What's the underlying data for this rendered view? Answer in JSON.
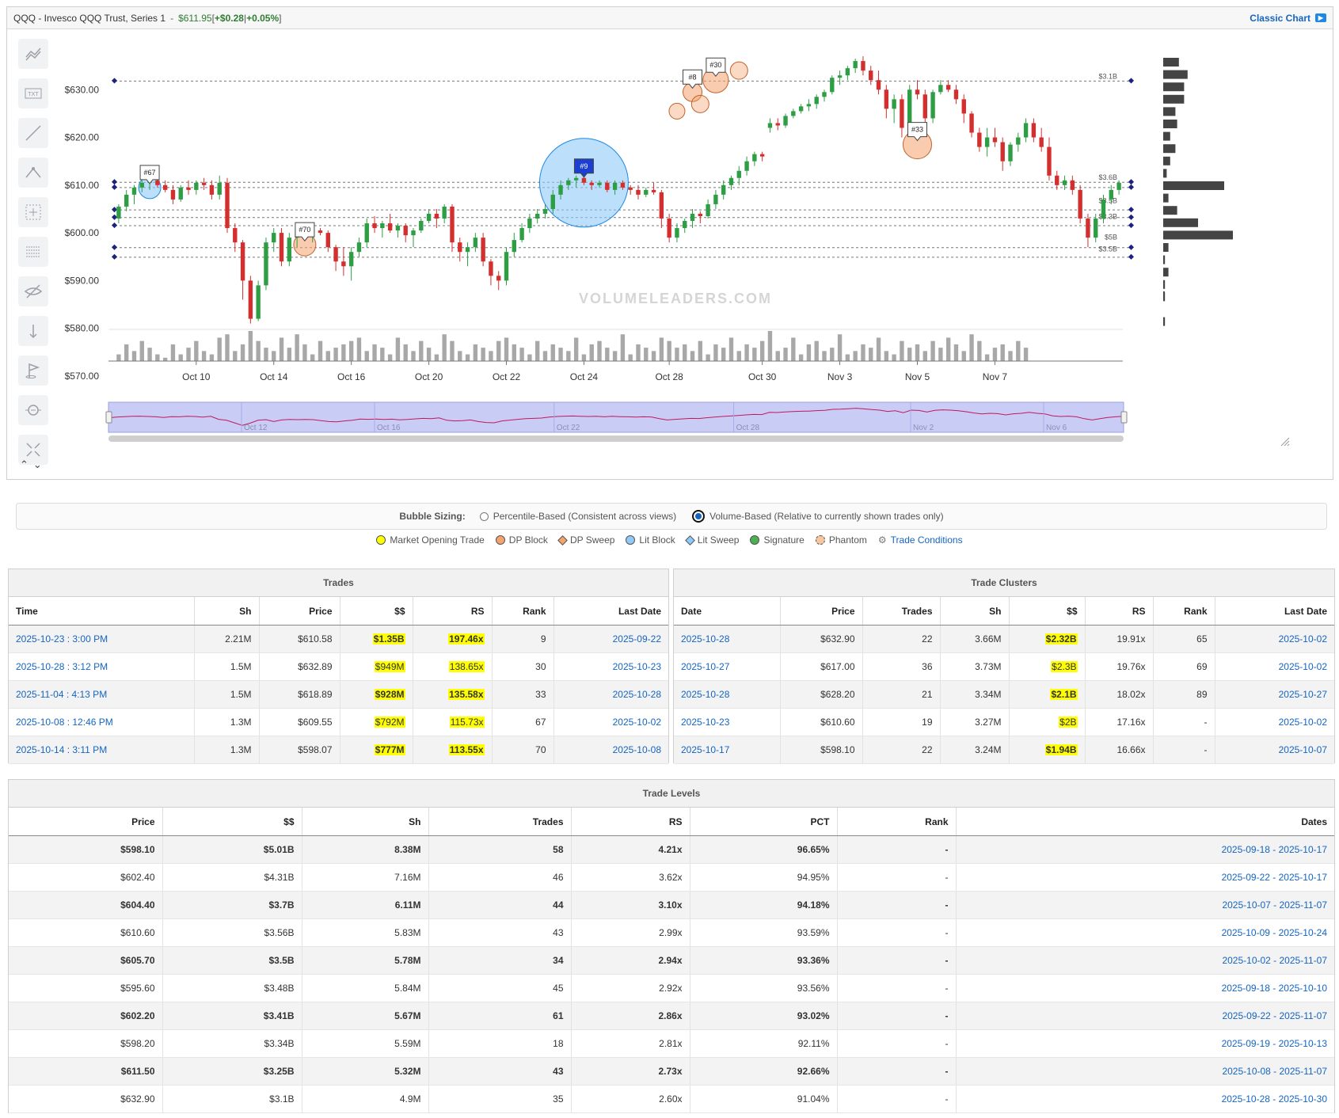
{
  "header": {
    "symbol": "QQQ - Invesco QQQ Trust, Series 1",
    "sep": " - ",
    "price": "$611.95",
    "bracket_open": " [ ",
    "change": "+$0.28",
    "pipe": " | ",
    "change_pct": "+0.05%",
    "bracket_close": " ]",
    "classic_chart": "Classic Chart"
  },
  "toolbar": {
    "tools": [
      "trend-lines-icon",
      "text-icon",
      "line-icon",
      "fibonacci-icon",
      "crosshair-icon",
      "levels-icon",
      "hide-icon",
      "measure-icon",
      "flag-icon",
      "zoom-icon",
      "fullscreen-icon"
    ],
    "arrows": [
      "⌃",
      "⌄"
    ]
  },
  "chart_data": {
    "type": "candlestick",
    "y_ticks": [
      "$630.00",
      "$620.00",
      "$610.00",
      "$600.00",
      "$590.00",
      "$580.00",
      "$570.00"
    ],
    "y_tick_values": [
      630,
      620,
      610,
      600,
      590,
      580,
      570
    ],
    "ylim": [
      567,
      640
    ],
    "x_ticks": [
      "Oct 10",
      "Oct 14",
      "Oct 16",
      "Oct 20",
      "Oct 22",
      "Oct 24",
      "Oct 28",
      "Oct 30",
      "Nov 3",
      "Nov 5",
      "Nov 7"
    ],
    "x_tick_index": [
      10,
      20,
      30,
      40,
      50,
      60,
      71,
      83,
      93,
      103,
      113
    ],
    "candles": [
      [
        603,
        606,
        602,
        605.5
      ],
      [
        605.5,
        609,
        604.5,
        608
      ],
      [
        608,
        610,
        606,
        609.5
      ],
      [
        609.5,
        611.5,
        608.5,
        610.5
      ],
      [
        610.5,
        612,
        609,
        611
      ],
      [
        611,
        612,
        609.5,
        610
      ],
      [
        610,
        611,
        608.5,
        609
      ],
      [
        609,
        610,
        606,
        607
      ],
      [
        607,
        610,
        606.5,
        609.5
      ],
      [
        609.5,
        611,
        608,
        609
      ],
      [
        609,
        611,
        608,
        610.5
      ],
      [
        610.5,
        611.5,
        609,
        610
      ],
      [
        610,
        611,
        607,
        608
      ],
      [
        608,
        612,
        607,
        610.5
      ],
      [
        610.5,
        611.5,
        600,
        601
      ],
      [
        601,
        602,
        596,
        598
      ],
      [
        598,
        598.5,
        586,
        590
      ],
      [
        590,
        591,
        581,
        582
      ],
      [
        582,
        590,
        581.5,
        589
      ],
      [
        589,
        599,
        588,
        598
      ],
      [
        598,
        601,
        596,
        600
      ],
      [
        600,
        601,
        593,
        594
      ],
      [
        594,
        600,
        593,
        599
      ],
      [
        599,
        601,
        597,
        600.5
      ],
      [
        600.5,
        601.5,
        599,
        600
      ],
      [
        600,
        601,
        598,
        600.5
      ],
      [
        600.5,
        601,
        599.5,
        600
      ],
      [
        600,
        600.5,
        596,
        597
      ],
      [
        597,
        597.5,
        592,
        594
      ],
      [
        594,
        597,
        591,
        593
      ],
      [
        593,
        597,
        590,
        596
      ],
      [
        596,
        599,
        595,
        598
      ],
      [
        598,
        603,
        597,
        602
      ],
      [
        602,
        603.5,
        600,
        601
      ],
      [
        601,
        602.5,
        599,
        602
      ],
      [
        602,
        604,
        600,
        600.5
      ],
      [
        600.5,
        602,
        599,
        601.5
      ],
      [
        601.5,
        602,
        598,
        599.5
      ],
      [
        599.5,
        601,
        597,
        600.5
      ],
      [
        600.5,
        603,
        600,
        602.5
      ],
      [
        602.5,
        605,
        602,
        604
      ],
      [
        604,
        605,
        601,
        603
      ],
      [
        603,
        606,
        602,
        605.5
      ],
      [
        605.5,
        606,
        596,
        598
      ],
      [
        598,
        599,
        594,
        596
      ],
      [
        596,
        598,
        593,
        597
      ],
      [
        597,
        600,
        596,
        599
      ],
      [
        599,
        600,
        593,
        594
      ],
      [
        594,
        594.5,
        589,
        591
      ],
      [
        591,
        592,
        588,
        590
      ],
      [
        590,
        597,
        589,
        596
      ],
      [
        596,
        600,
        595,
        598.5
      ],
      [
        598.5,
        602,
        598,
        601
      ],
      [
        601,
        604,
        600,
        603
      ],
      [
        603,
        605,
        602,
        604
      ],
      [
        604,
        606,
        603,
        605
      ],
      [
        605,
        609,
        604,
        608
      ],
      [
        608,
        611,
        607,
        610
      ],
      [
        610,
        611.5,
        609,
        611
      ],
      [
        611,
        612,
        609.5,
        611.5
      ],
      [
        611.5,
        612,
        610,
        610.5
      ],
      [
        610.5,
        611,
        609,
        610
      ],
      [
        610,
        611,
        609.5,
        610.5
      ],
      [
        610.5,
        611,
        608.5,
        609
      ],
      [
        609,
        611,
        608,
        610.5
      ],
      [
        610.5,
        611,
        609,
        609.5
      ],
      [
        609.5,
        610,
        608,
        609
      ],
      [
        609,
        610,
        607,
        608
      ],
      [
        608,
        609.5,
        607.5,
        609
      ],
      [
        609,
        610.5,
        608,
        608.5
      ],
      [
        608.5,
        609,
        601,
        603
      ],
      [
        603,
        604,
        598,
        599
      ],
      [
        599,
        602,
        598,
        601
      ],
      [
        601,
        603,
        600,
        602.5
      ],
      [
        602.5,
        605,
        601,
        604
      ],
      [
        604,
        604.5,
        602,
        603.5
      ],
      [
        603.5,
        607,
        603,
        606
      ],
      [
        606,
        609,
        605,
        608
      ],
      [
        608,
        611,
        607,
        610
      ],
      [
        610,
        612,
        609,
        611.5
      ],
      [
        611.5,
        614,
        610,
        613
      ],
      [
        613,
        616,
        612,
        615
      ],
      [
        615,
        617,
        614,
        616.5
      ],
      [
        616.5,
        617,
        615,
        616
      ],
      [
        622,
        624,
        621,
        623
      ],
      [
        623,
        624,
        621.5,
        622.5
      ],
      [
        622.5,
        625,
        622,
        624.5
      ],
      [
        624.5,
        626,
        624,
        625.5
      ],
      [
        625.5,
        627,
        625,
        626.5
      ],
      [
        626.5,
        628,
        625.5,
        627
      ],
      [
        627,
        629,
        626,
        628.5
      ],
      [
        628.5,
        630,
        627.5,
        629.5
      ],
      [
        629.5,
        633,
        629,
        632.5
      ],
      [
        632.5,
        634,
        631,
        633
      ],
      [
        633,
        635,
        632,
        634.5
      ],
      [
        634.5,
        636.5,
        633.5,
        636
      ],
      [
        636,
        637,
        633,
        634
      ],
      [
        634,
        635,
        631,
        632
      ],
      [
        632,
        634,
        629,
        630
      ],
      [
        630,
        631,
        624,
        626
      ],
      [
        626,
        629,
        623,
        628
      ],
      [
        628,
        629,
        620,
        622
      ],
      [
        622,
        631,
        621,
        630
      ],
      [
        630,
        632,
        628,
        629
      ],
      [
        629,
        630,
        622,
        624
      ],
      [
        624,
        630,
        623,
        629.5
      ],
      [
        629.5,
        632,
        629,
        631
      ],
      [
        631,
        632,
        629.5,
        630
      ],
      [
        630,
        631,
        627,
        628
      ],
      [
        628,
        629,
        623,
        625
      ],
      [
        625,
        625.5,
        620,
        621
      ],
      [
        621,
        622,
        617,
        618
      ],
      [
        618,
        622,
        616,
        620
      ],
      [
        620,
        622,
        618,
        619
      ],
      [
        619,
        620,
        613,
        615
      ],
      [
        615,
        619,
        614,
        618.5
      ],
      [
        618.5,
        621,
        617,
        620
      ],
      [
        620,
        624,
        619,
        623
      ],
      [
        623,
        624,
        619,
        620
      ],
      [
        620,
        622,
        617,
        618
      ],
      [
        618,
        620,
        611,
        612
      ],
      [
        612,
        613,
        609,
        610
      ],
      [
        610,
        612,
        609,
        611
      ],
      [
        611,
        612,
        608,
        609
      ],
      [
        609,
        610,
        602,
        603
      ],
      [
        603,
        604,
        597,
        599
      ],
      [
        599,
        604,
        598,
        603
      ],
      [
        603,
        608,
        602,
        607
      ],
      [
        607,
        610,
        606,
        609
      ],
      [
        609,
        611,
        608,
        610.5
      ]
    ],
    "volume": [
      2,
      5,
      3,
      6,
      4,
      2,
      1,
      5,
      2,
      4,
      6,
      3,
      2,
      7,
      8,
      3,
      5,
      9,
      6,
      4,
      3,
      7,
      4,
      8,
      5,
      2,
      6,
      3,
      4,
      5,
      6,
      7,
      3,
      5,
      4,
      2,
      7,
      5,
      3,
      6,
      4,
      2,
      8,
      6,
      3,
      2,
      5,
      4,
      3,
      6,
      7,
      5,
      4,
      2,
      6,
      3,
      5,
      4,
      3,
      7,
      2,
      5,
      6,
      4,
      3,
      8,
      2,
      5,
      4,
      3,
      7,
      6,
      4,
      5,
      3,
      6,
      2,
      5,
      4,
      7,
      3,
      5,
      4,
      6,
      9,
      3,
      4,
      7,
      2,
      5,
      6,
      3,
      4,
      8,
      2,
      3,
      5,
      4,
      7,
      3,
      2,
      6,
      4,
      5,
      3,
      6,
      4,
      7,
      5,
      3,
      8,
      6,
      2,
      4,
      5,
      3,
      6,
      4
    ],
    "levels": [
      631.8,
      610.6,
      609.5,
      604.8,
      603.2,
      601.5,
      596.9,
      594.9
    ],
    "level_labels": [
      {
        "text": "$3.1B",
        "price": 631.8
      },
      {
        "text": "$3.6B",
        "price": 610.6
      },
      {
        "text": "$3.5B",
        "price": 605.7
      },
      {
        "text": "$3.3B",
        "price": 602.4
      },
      {
        "text": "$5B",
        "price": 598.1
      },
      {
        "text": "$3.5B",
        "price": 595.6
      }
    ],
    "profile": [
      9,
      14,
      12,
      12,
      7,
      8,
      4,
      7,
      4,
      2,
      35,
      3,
      8,
      20,
      40,
      3,
      1,
      3,
      1,
      1,
      0,
      1
    ],
    "markers": [
      {
        "label": "#67",
        "index": 4,
        "price": 609.5,
        "type": "lit",
        "r": 14
      },
      {
        "label": "#70",
        "index": 24,
        "price": 597.5,
        "type": "dp",
        "r": 14
      },
      {
        "label": "#9",
        "index": 60,
        "price": 610.5,
        "type": "lit",
        "r": 56
      },
      {
        "label": "#30",
        "index": 77,
        "price": 632,
        "type": "dp",
        "r": 16
      },
      {
        "label": "#8",
        "index": 74,
        "price": 629.5,
        "type": "dp",
        "r": 12
      },
      {
        "label": "#33",
        "index": 103,
        "price": 618.5,
        "type": "dp",
        "r": 18
      }
    ],
    "watermark": "VOLUMELEADERS.COM",
    "navigator_ticks": [
      "Oct 12",
      "Oct 16",
      "Oct 22",
      "Oct 28",
      "Nov 2",
      "Nov 6"
    ]
  },
  "bubble_sizing": {
    "label": "Bubble Sizing:",
    "option1": "Percentile-Based (Consistent across views)",
    "option2": "Volume-Based (Relative to currently shown trades only)"
  },
  "legend": [
    {
      "label": "Market Opening Trade",
      "color": "#ffff00",
      "shape": "dot"
    },
    {
      "label": "DP Block",
      "color": "#f4a26e",
      "shape": "dot"
    },
    {
      "label": "DP Sweep",
      "color": "#f4a26e",
      "shape": "diamond"
    },
    {
      "label": "Lit Block",
      "color": "#90caf9",
      "shape": "dot"
    },
    {
      "label": "Lit Sweep",
      "color": "#90caf9",
      "shape": "diamond"
    },
    {
      "label": "Signature",
      "color": "#4caf50",
      "shape": "dot"
    },
    {
      "label": "Phantom",
      "color": "#f4c7a0",
      "shape": "phantom"
    }
  ],
  "trade_conditions": "Trade Conditions",
  "trades": {
    "title": "Trades",
    "columns": [
      "Time",
      "Sh",
      "Price",
      "$$",
      "RS",
      "Rank",
      "Last Date"
    ],
    "rows": [
      [
        "2025-10-23 : 3:00 PM",
        "2.21M",
        "$610.58",
        "$1.35B",
        "197.46x",
        "9",
        "2025-09-22"
      ],
      [
        "2025-10-28 : 3:12 PM",
        "1.5M",
        "$632.89",
        "$949M",
        "138.65x",
        "30",
        "2025-10-23"
      ],
      [
        "2025-11-04 : 4:13 PM",
        "1.5M",
        "$618.89",
        "$928M",
        "135.58x",
        "33",
        "2025-10-28"
      ],
      [
        "2025-10-08 : 12:46 PM",
        "1.3M",
        "$609.55",
        "$792M",
        "115.73x",
        "67",
        "2025-10-02"
      ],
      [
        "2025-10-14 : 3:11 PM",
        "1.3M",
        "$598.07",
        "$777M",
        "113.55x",
        "70",
        "2025-10-08"
      ]
    ]
  },
  "clusters": {
    "title": "Trade Clusters",
    "columns": [
      "Date",
      "Price",
      "Trades",
      "Sh",
      "$$",
      "RS",
      "Rank",
      "Last Date"
    ],
    "rows": [
      [
        "2025-10-28",
        "$632.90",
        "22",
        "3.66M",
        "$2.32B",
        "19.91x",
        "65",
        "2025-10-02"
      ],
      [
        "2025-10-27",
        "$617.00",
        "36",
        "3.73M",
        "$2.3B",
        "19.76x",
        "69",
        "2025-10-02"
      ],
      [
        "2025-10-28",
        "$628.20",
        "21",
        "3.34M",
        "$2.1B",
        "18.02x",
        "89",
        "2025-10-27"
      ],
      [
        "2025-10-23",
        "$610.60",
        "19",
        "3.27M",
        "$2B",
        "17.16x",
        "-",
        "2025-10-02"
      ],
      [
        "2025-10-17",
        "$598.10",
        "22",
        "3.24M",
        "$1.94B",
        "16.66x",
        "-",
        "2025-10-07"
      ]
    ]
  },
  "levels": {
    "title": "Trade Levels",
    "columns": [
      "Price",
      "$$",
      "Sh",
      "Trades",
      "RS",
      "PCT",
      "Rank",
      "Dates"
    ],
    "rows": [
      [
        "$598.10",
        "$5.01B",
        "8.38M",
        "58",
        "4.21x",
        "96.65%",
        "-",
        "2025-09-18 - 2025-10-17"
      ],
      [
        "$602.40",
        "$4.31B",
        "7.16M",
        "46",
        "3.62x",
        "94.95%",
        "-",
        "2025-09-22 - 2025-10-17"
      ],
      [
        "$604.40",
        "$3.7B",
        "6.11M",
        "44",
        "3.10x",
        "94.18%",
        "-",
        "2025-10-07 - 2025-11-07"
      ],
      [
        "$610.60",
        "$3.56B",
        "5.83M",
        "43",
        "2.99x",
        "93.59%",
        "-",
        "2025-10-09 - 2025-10-24"
      ],
      [
        "$605.70",
        "$3.5B",
        "5.78M",
        "34",
        "2.94x",
        "93.36%",
        "-",
        "2025-10-02 - 2025-11-07"
      ],
      [
        "$595.60",
        "$3.48B",
        "5.84M",
        "45",
        "2.92x",
        "93.56%",
        "-",
        "2025-09-18 - 2025-10-10"
      ],
      [
        "$602.20",
        "$3.41B",
        "5.67M",
        "61",
        "2.86x",
        "93.02%",
        "-",
        "2025-09-22 - 2025-11-07"
      ],
      [
        "$598.20",
        "$3.34B",
        "5.59M",
        "18",
        "2.81x",
        "92.11%",
        "-",
        "2025-09-19 - 2025-10-13"
      ],
      [
        "$611.50",
        "$3.25B",
        "5.32M",
        "43",
        "2.73x",
        "92.66%",
        "-",
        "2025-10-08 - 2025-11-07"
      ],
      [
        "$632.90",
        "$3.1B",
        "4.9M",
        "35",
        "2.60x",
        "91.04%",
        "-",
        "2025-10-28 - 2025-10-30"
      ]
    ]
  },
  "colors": {
    "up": "#2e9e44",
    "down": "#d32f2f",
    "highlight": "#ffff00",
    "link": "#1565c0"
  }
}
